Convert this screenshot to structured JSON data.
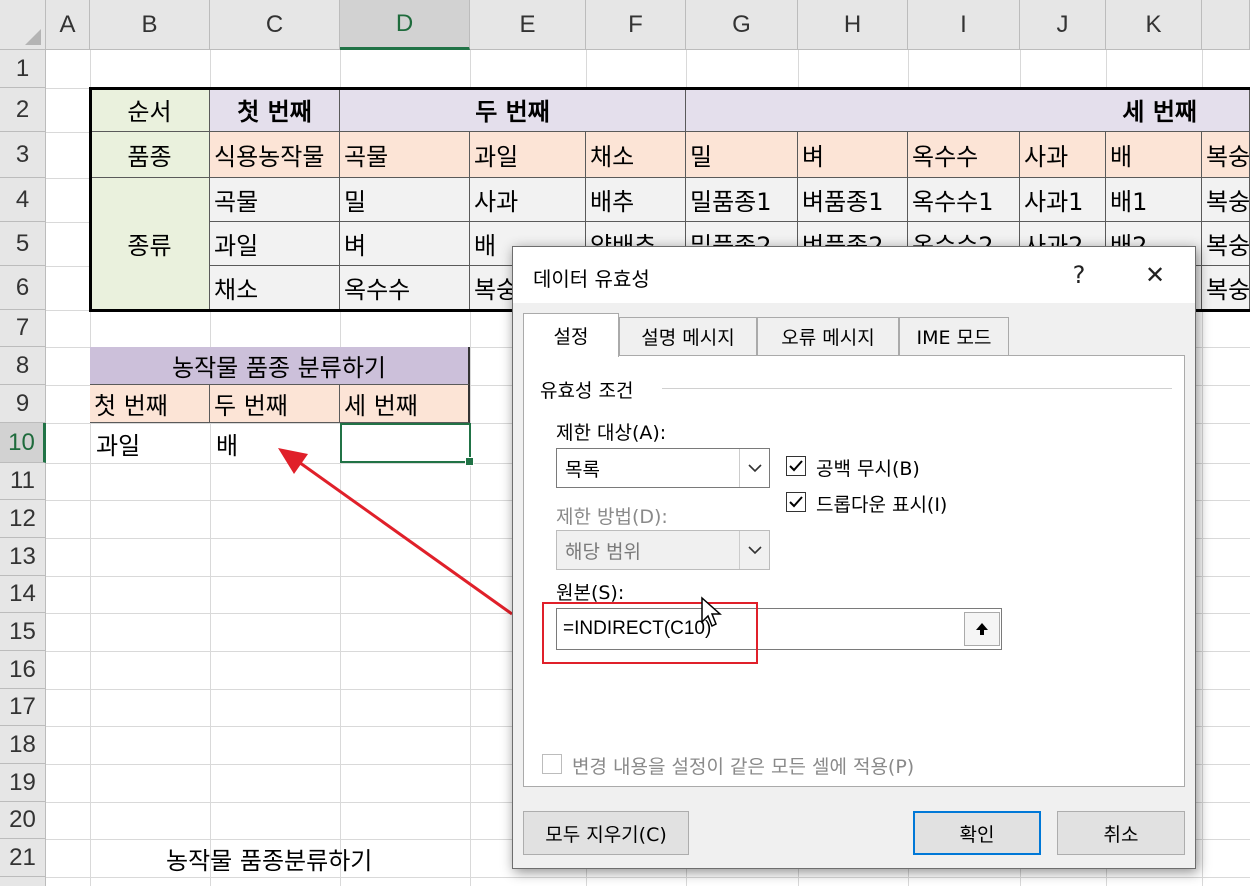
{
  "sheet": {
    "columns": [
      "A",
      "B",
      "C",
      "D",
      "E",
      "F",
      "G",
      "H",
      "I",
      "J",
      "K"
    ],
    "selected_column": "D",
    "rows": [
      "1",
      "2",
      "3",
      "4",
      "5",
      "6",
      "7",
      "8",
      "9",
      "10",
      "11",
      "12",
      "13",
      "14",
      "15",
      "16",
      "17",
      "18",
      "19",
      "20",
      "21"
    ],
    "selected_row": "10",
    "table1": {
      "r2": [
        "순서",
        "첫 번째",
        "두 번째",
        "세 번째"
      ],
      "r3": [
        "품종",
        "식용농작물",
        "곡물",
        "과일",
        "채소",
        "밀",
        "벼",
        "옥수수",
        "사과",
        "배",
        "복숭"
      ],
      "group_label": "종류",
      "r4": [
        "곡물",
        "밀",
        "사과",
        "배추",
        "밀품종1",
        "벼품종1",
        "옥수수1",
        "사과1",
        "배1",
        "복숭"
      ],
      "r5": [
        "과일",
        "벼",
        "배",
        "양배추",
        "밀품종2",
        "벼품종2",
        "옥수수2",
        "사과2",
        "배2",
        "복숭"
      ],
      "r6": [
        "채소",
        "옥수수",
        "복숭",
        "복숭"
      ]
    },
    "table2": {
      "title": "농작물 품종 분류하기",
      "headers": [
        "첫 번째",
        "두 번째",
        "세 번째"
      ],
      "values": [
        "과일",
        "배"
      ]
    },
    "footer_text": "농작물 품종분류하기"
  },
  "dialog": {
    "title": "데이터 유효성",
    "help": "?",
    "close": "✕",
    "tabs": [
      "설정",
      "설명 메시지",
      "오류 메시지",
      "IME 모드"
    ],
    "group_title": "유효성 조건",
    "allow_label": "제한 대상(A):",
    "allow_value": "목록",
    "ignore_blank": "공백 무시(B)",
    "dropdown": "드롭다운 표시(I)",
    "data_label": "제한 방법(D):",
    "data_value": "해당 범위",
    "source_label": "원본(S):",
    "source_value": "=INDIRECT(C10)",
    "apply_all": "변경 내용을 설정이 같은 모든 셀에 적용(P)",
    "clear_all": "모두 지우기(C)",
    "ok": "확인",
    "cancel": "취소"
  },
  "colors": {
    "accent": "#217346",
    "highlight": "#e0202a",
    "focus": "#0078d7"
  }
}
